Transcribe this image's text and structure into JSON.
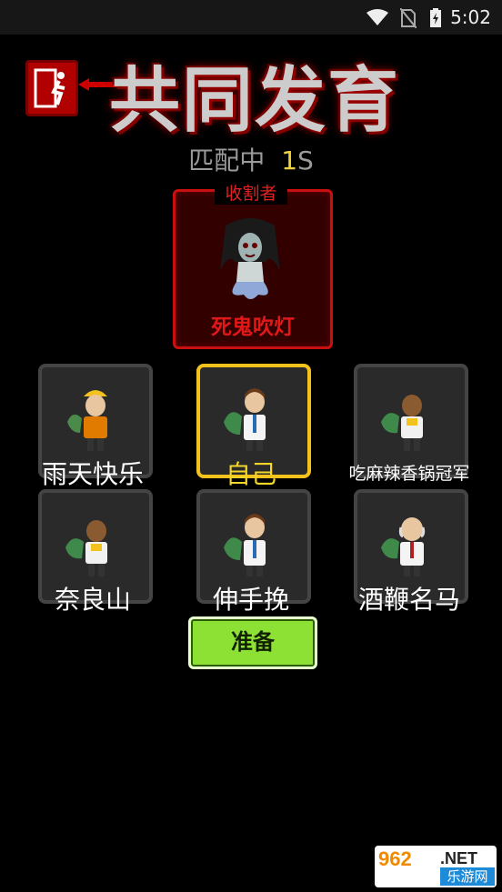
{
  "status_bar": {
    "time": "5:02",
    "icons": [
      "wifi-icon",
      "no-sim-icon",
      "battery-charging-icon"
    ]
  },
  "header": {
    "game_title": "共同发育",
    "icon": "exit-sign-icon"
  },
  "match": {
    "status": "匹配中",
    "timer_value": "1",
    "timer_unit": "S"
  },
  "reaper": {
    "label": "收割者",
    "name": "死鬼吹灯",
    "icon": "ghost-character-icon"
  },
  "players": [
    {
      "name": "雨天快乐",
      "avatar": "worker-hardhat-avatar",
      "self": false
    },
    {
      "name": "自己",
      "avatar": "doctor-avatar",
      "self": true
    },
    {
      "name": "吃麻辣香锅冠军",
      "avatar": "pop-cap-avatar",
      "self": false
    },
    {
      "name": "奈良山",
      "avatar": "pop-cap-avatar",
      "self": false
    },
    {
      "name": "伸手挽",
      "avatar": "doctor-avatar",
      "self": false
    },
    {
      "name": "酒鞭名马",
      "avatar": "bald-scientist-avatar",
      "self": false
    }
  ],
  "ready_button": {
    "label": "准备"
  },
  "watermark": {
    "number": "962",
    "net": ".NET",
    "cn": "乐游网"
  },
  "colors": {
    "self_highlight": "#f3c21c",
    "reaper_red": "#c81010",
    "ready_green": "#8de034",
    "timer_yellow": "#f0d23a"
  }
}
